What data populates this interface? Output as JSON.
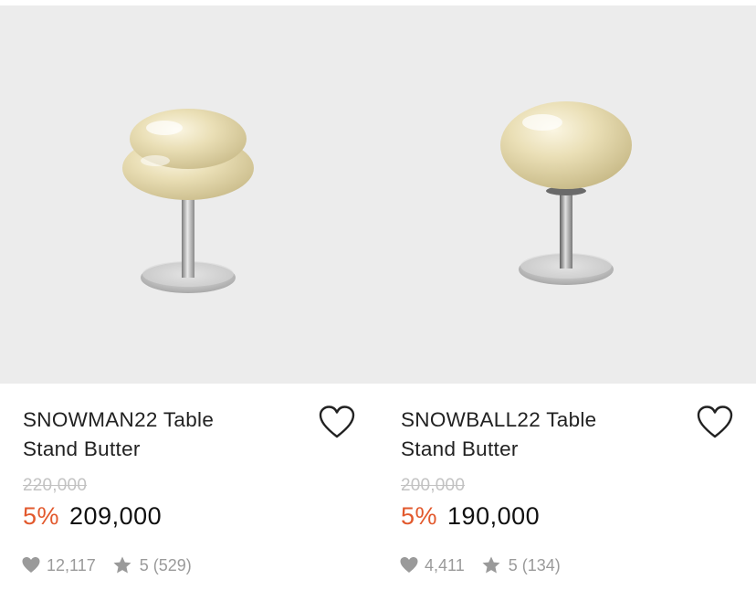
{
  "products": [
    {
      "title_line1": "SNOWMAN22 Table",
      "title_line2": "Stand Butter",
      "original_price": "220,000",
      "discount": "5%",
      "price": "209,000",
      "likes": "12,117",
      "rating": "5 (529)",
      "image_icon": "snowman-lamp-image",
      "wishlist_icon": "heart-outline-icon"
    },
    {
      "title_line1": "SNOWBALL22 Table",
      "title_line2": "Stand Butter",
      "original_price": "200,000",
      "discount": "5%",
      "price": "190,000",
      "likes": "4,411",
      "rating": "5 (134)",
      "image_icon": "snowball-lamp-image",
      "wishlist_icon": "heart-outline-icon"
    }
  ],
  "colors": {
    "discount": "#e2592d",
    "image_bg": "#ececec",
    "muted": "#9a9a9a",
    "strike": "#c2c2c2"
  }
}
